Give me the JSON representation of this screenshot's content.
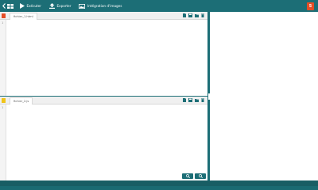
{
  "toolbar": {
    "back_icon": "chevron-left-grid-icon",
    "execute_label": "Exécuter",
    "export_label": "Exporter",
    "images_label": "Intégration d'images",
    "badge": "5"
  },
  "editors": [
    {
      "tab_label": "fichier_1.html",
      "line_number": "1",
      "icon_color": "#e44d26"
    },
    {
      "tab_label": "fichier_2.js",
      "line_number": "1",
      "icon_color": "#f0c419"
    }
  ],
  "colors": {
    "accent": "#1c6e76",
    "preview_bg": "#ffffff"
  },
  "zoom": {
    "in_icon": "zoom-in-icon",
    "out_icon": "zoom-out-icon"
  }
}
